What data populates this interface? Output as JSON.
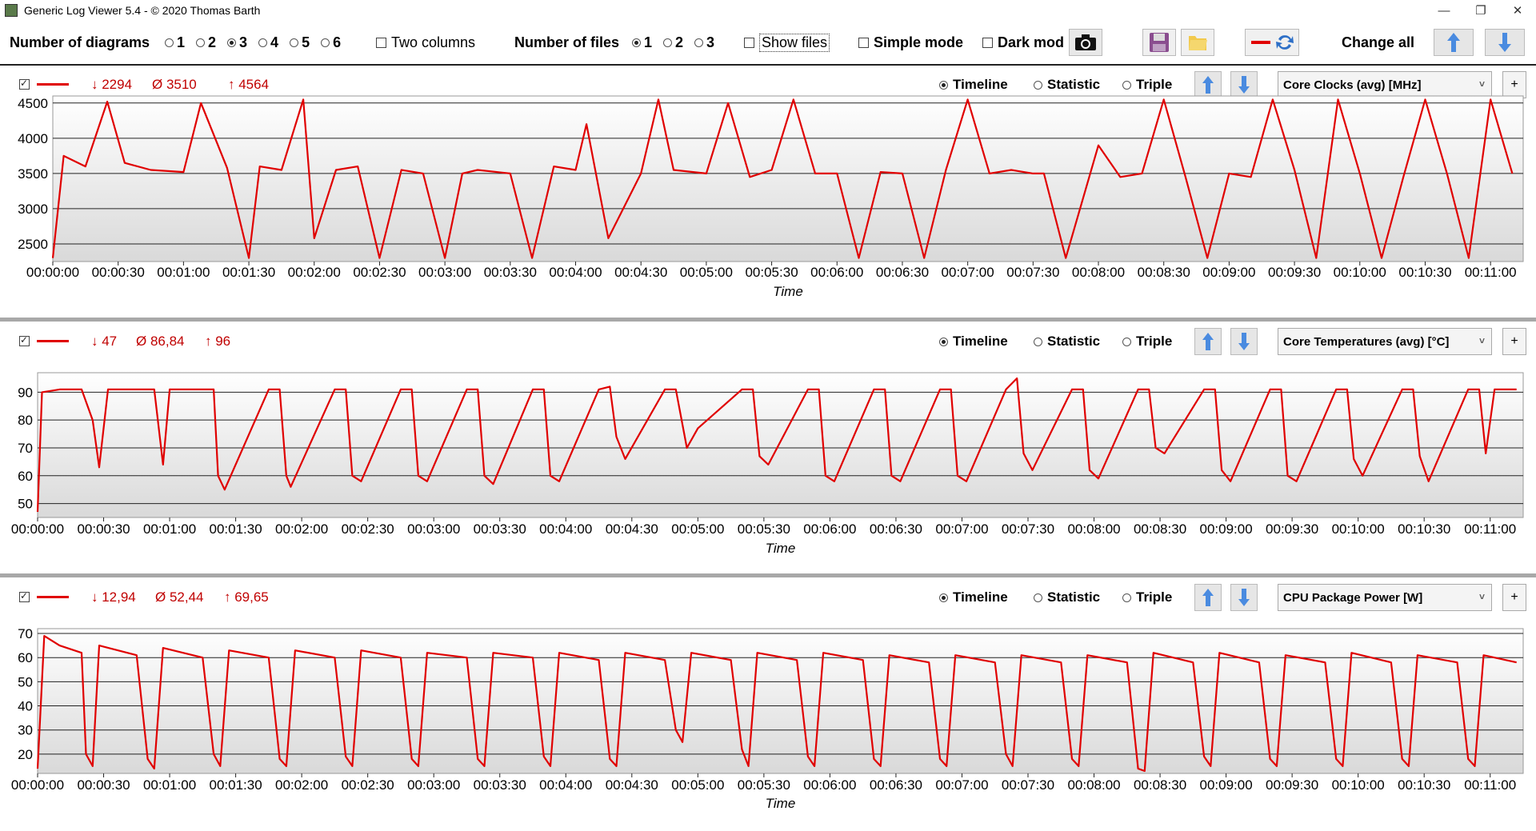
{
  "window": {
    "title": "Generic Log Viewer 5.4 - © 2020 Thomas Barth",
    "min": "—",
    "max": "❐",
    "close": "✕"
  },
  "toolbar": {
    "num_diagrams_label": "Number of diagrams",
    "diagram_options": [
      "1",
      "2",
      "3",
      "4",
      "5",
      "6"
    ],
    "diagram_selected": "3",
    "two_columns": "Two columns",
    "num_files_label": "Number of files",
    "file_options": [
      "1",
      "2",
      "3"
    ],
    "file_selected": "1",
    "show_files": "Show files",
    "simple_mode": "Simple mode",
    "dark_mode": "Dark mod",
    "change_all": "Change all"
  },
  "panels": [
    {
      "stats": {
        "min": "↓ 2294",
        "avg": "Ø 3510",
        "max": "↑ 4564"
      },
      "modes": [
        "Timeline",
        "Statistic",
        "Triple"
      ],
      "mode_selected": "Timeline",
      "sensor": "Core Clocks (avg) [MHz]",
      "plus": "+",
      "xlabel": "Time",
      "xticks": [
        "00:00:00",
        "00:00:30",
        "00:01:00",
        "00:01:30",
        "00:02:00",
        "00:02:30",
        "00:03:00",
        "00:03:30",
        "00:04:00",
        "00:04:30",
        "00:05:00",
        "00:05:30",
        "00:06:00",
        "00:06:30",
        "00:07:00",
        "00:07:30",
        "00:08:00",
        "00:08:30",
        "00:09:00",
        "00:09:30",
        "00:10:00",
        "00:10:30",
        "00:11:00"
      ],
      "yticks": [
        "2500",
        "3000",
        "3500",
        "4000",
        "4500"
      ]
    },
    {
      "stats": {
        "min": "↓ 47",
        "avg": "Ø 86,84",
        "max": "↑ 96"
      },
      "modes": [
        "Timeline",
        "Statistic",
        "Triple"
      ],
      "mode_selected": "Timeline",
      "sensor": "Core Temperatures (avg) [°C]",
      "plus": "+",
      "xlabel": "Time",
      "xticks": [
        "00:00:00",
        "00:00:30",
        "00:01:00",
        "00:01:30",
        "00:02:00",
        "00:02:30",
        "00:03:00",
        "00:03:30",
        "00:04:00",
        "00:04:30",
        "00:05:00",
        "00:05:30",
        "00:06:00",
        "00:06:30",
        "00:07:00",
        "00:07:30",
        "00:08:00",
        "00:08:30",
        "00:09:00",
        "00:09:30",
        "00:10:00",
        "00:10:30",
        "00:11:00"
      ],
      "yticks": [
        "50",
        "60",
        "70",
        "80",
        "90"
      ]
    },
    {
      "stats": {
        "min": "↓ 12,94",
        "avg": "Ø 52,44",
        "max": "↑ 69,65"
      },
      "modes": [
        "Timeline",
        "Statistic",
        "Triple"
      ],
      "mode_selected": "Timeline",
      "sensor": "CPU Package Power [W]",
      "plus": "+",
      "xlabel": "Time",
      "xticks": [
        "00:00:00",
        "00:00:30",
        "00:01:00",
        "00:01:30",
        "00:02:00",
        "00:02:30",
        "00:03:00",
        "00:03:30",
        "00:04:00",
        "00:04:30",
        "00:05:00",
        "00:05:30",
        "00:06:00",
        "00:06:30",
        "00:07:00",
        "00:07:30",
        "00:08:00",
        "00:08:30",
        "00:09:00",
        "00:09:30",
        "00:10:00",
        "00:10:30",
        "00:11:00"
      ],
      "yticks": [
        "20",
        "30",
        "40",
        "50",
        "60",
        "70"
      ]
    }
  ],
  "chart_data": [
    {
      "type": "line",
      "ylabel": "Core Clocks (avg) [MHz]",
      "xlabel": "Time",
      "ylim": [
        2250,
        4600
      ],
      "xlim": [
        "00:00:00",
        "00:11:15"
      ],
      "grid": true,
      "series_color": "#e00000",
      "summary": {
        "min": 2294,
        "avg": 3510,
        "max": 4564
      },
      "x": [
        "00:00:00",
        "00:00:05",
        "00:00:15",
        "00:00:25",
        "00:00:33",
        "00:00:45",
        "00:01:00",
        "00:01:08",
        "00:01:20",
        "00:01:30",
        "00:01:35",
        "00:01:45",
        "00:01:55",
        "00:02:00",
        "00:02:10",
        "00:02:20",
        "00:02:30",
        "00:02:40",
        "00:02:50",
        "00:03:00",
        "00:03:08",
        "00:03:15",
        "00:03:30",
        "00:03:40",
        "00:03:50",
        "00:04:00",
        "00:04:05",
        "00:04:15",
        "00:04:30",
        "00:04:38",
        "00:04:45",
        "00:05:00",
        "00:05:10",
        "00:05:20",
        "00:05:30",
        "00:05:40",
        "00:05:50",
        "00:06:00",
        "00:06:10",
        "00:06:20",
        "00:06:30",
        "00:06:40",
        "00:06:50",
        "00:07:00",
        "00:07:10",
        "00:07:20",
        "00:07:30",
        "00:07:35",
        "00:07:45",
        "00:08:00",
        "00:08:10",
        "00:08:20",
        "00:08:30",
        "00:08:40",
        "00:08:50",
        "00:09:00",
        "00:09:10",
        "00:09:20",
        "00:09:30",
        "00:09:40",
        "00:09:50",
        "00:10:00",
        "00:10:10",
        "00:10:20",
        "00:10:30",
        "00:10:40",
        "00:10:50",
        "00:11:00",
        "00:11:10"
      ],
      "y": [
        2300,
        3750,
        3600,
        4520,
        3650,
        3550,
        3520,
        4500,
        3580,
        2300,
        3600,
        3550,
        4550,
        2580,
        3550,
        3600,
        2300,
        3550,
        3500,
        2300,
        3500,
        3550,
        3500,
        2300,
        3600,
        3550,
        4200,
        2580,
        3500,
        4550,
        3550,
        3500,
        4500,
        3450,
        3550,
        4550,
        3500,
        3500,
        2300,
        3520,
        3500,
        2300,
        3550,
        4550,
        3500,
        3550,
        3500,
        3500,
        2300,
        3900,
        3450,
        3500,
        4550,
        3450,
        2300,
        3500,
        3450,
        4550,
        3550,
        2300,
        4550,
        3500,
        2300,
        3450,
        4550,
        3500,
        2300,
        4550,
        3500
      ]
    },
    {
      "type": "line",
      "ylabel": "Core Temperatures (avg) [°C]",
      "xlabel": "Time",
      "ylim": [
        45,
        97
      ],
      "xlim": [
        "00:00:00",
        "00:11:15"
      ],
      "grid": true,
      "series_color": "#e00000",
      "summary": {
        "min": 47,
        "avg": 86.84,
        "max": 96
      },
      "x": [
        "00:00:00",
        "00:00:02",
        "00:00:10",
        "00:00:20",
        "00:00:25",
        "00:00:28",
        "00:00:32",
        "00:00:45",
        "00:00:53",
        "00:00:57",
        "00:01:00",
        "00:01:15",
        "00:01:20",
        "00:01:22",
        "00:01:25",
        "00:01:45",
        "00:01:50",
        "00:01:53",
        "00:01:55",
        "00:02:15",
        "00:02:20",
        "00:02:23",
        "00:02:27",
        "00:02:45",
        "00:02:50",
        "00:02:53",
        "00:02:57",
        "00:03:15",
        "00:03:20",
        "00:03:23",
        "00:03:27",
        "00:03:45",
        "00:03:50",
        "00:03:53",
        "00:03:57",
        "00:04:15",
        "00:04:20",
        "00:04:23",
        "00:04:27",
        "00:04:45",
        "00:04:50",
        "00:04:55",
        "00:05:00",
        "00:05:20",
        "00:05:25",
        "00:05:28",
        "00:05:32",
        "00:05:50",
        "00:05:55",
        "00:05:58",
        "00:06:02",
        "00:06:20",
        "00:06:25",
        "00:06:28",
        "00:06:32",
        "00:06:50",
        "00:06:55",
        "00:06:58",
        "00:07:02",
        "00:07:20",
        "00:07:25",
        "00:07:28",
        "00:07:32",
        "00:07:50",
        "00:07:55",
        "00:07:58",
        "00:08:02",
        "00:08:20",
        "00:08:25",
        "00:08:28",
        "00:08:32",
        "00:08:50",
        "00:08:55",
        "00:08:58",
        "00:09:02",
        "00:09:20",
        "00:09:25",
        "00:09:28",
        "00:09:32",
        "00:09:50",
        "00:09:55",
        "00:09:58",
        "00:10:02",
        "00:10:20",
        "00:10:25",
        "00:10:28",
        "00:10:32",
        "00:10:50",
        "00:10:55",
        "00:10:58",
        "00:11:02",
        "00:11:12"
      ],
      "y": [
        47,
        90,
        91,
        91,
        80,
        63,
        91,
        91,
        91,
        64,
        91,
        91,
        91,
        60,
        55,
        91,
        91,
        60,
        56,
        91,
        91,
        60,
        58,
        91,
        91,
        60,
        58,
        91,
        91,
        60,
        57,
        91,
        91,
        60,
        58,
        91,
        92,
        74,
        66,
        91,
        91,
        70,
        77,
        91,
        91,
        67,
        64,
        91,
        91,
        60,
        58,
        91,
        91,
        60,
        58,
        91,
        91,
        60,
        58,
        91,
        95,
        68,
        62,
        91,
        91,
        62,
        59,
        91,
        91,
        70,
        68,
        91,
        91,
        62,
        58,
        91,
        91,
        60,
        58,
        91,
        91,
        66,
        60,
        91,
        91,
        67,
        58,
        91,
        91,
        68,
        91,
        91
      ]
    },
    {
      "type": "line",
      "ylabel": "CPU Package Power [W]",
      "xlabel": "Time",
      "ylim": [
        12,
        72
      ],
      "xlim": [
        "00:00:00",
        "00:11:15"
      ],
      "grid": true,
      "series_color": "#e00000",
      "summary": {
        "min": 12.94,
        "avg": 52.44,
        "max": 69.65
      },
      "x": [
        "00:00:00",
        "00:00:03",
        "00:00:10",
        "00:00:20",
        "00:00:22",
        "00:00:25",
        "00:00:28",
        "00:00:45",
        "00:00:50",
        "00:00:53",
        "00:00:57",
        "00:01:15",
        "00:01:20",
        "00:01:23",
        "00:01:27",
        "00:01:45",
        "00:01:50",
        "00:01:53",
        "00:01:57",
        "00:02:15",
        "00:02:20",
        "00:02:23",
        "00:02:27",
        "00:02:45",
        "00:02:50",
        "00:02:53",
        "00:02:57",
        "00:03:15",
        "00:03:20",
        "00:03:23",
        "00:03:27",
        "00:03:45",
        "00:03:50",
        "00:03:53",
        "00:03:57",
        "00:04:15",
        "00:04:20",
        "00:04:23",
        "00:04:27",
        "00:04:45",
        "00:04:50",
        "00:04:53",
        "00:04:57",
        "00:05:15",
        "00:05:20",
        "00:05:23",
        "00:05:27",
        "00:05:45",
        "00:05:50",
        "00:05:53",
        "00:05:57",
        "00:06:15",
        "00:06:20",
        "00:06:23",
        "00:06:27",
        "00:06:45",
        "00:06:50",
        "00:06:53",
        "00:06:57",
        "00:07:15",
        "00:07:20",
        "00:07:23",
        "00:07:27",
        "00:07:45",
        "00:07:50",
        "00:07:53",
        "00:07:57",
        "00:08:15",
        "00:08:20",
        "00:08:23",
        "00:08:27",
        "00:08:45",
        "00:08:50",
        "00:08:53",
        "00:08:57",
        "00:09:15",
        "00:09:20",
        "00:09:23",
        "00:09:27",
        "00:09:45",
        "00:09:50",
        "00:09:53",
        "00:09:57",
        "00:10:15",
        "00:10:20",
        "00:10:23",
        "00:10:27",
        "00:10:45",
        "00:10:50",
        "00:10:53",
        "00:10:57",
        "00:11:12"
      ],
      "y": [
        14,
        69,
        65,
        62,
        20,
        15,
        65,
        61,
        18,
        14,
        64,
        60,
        20,
        15,
        63,
        60,
        18,
        15,
        63,
        60,
        19,
        15,
        63,
        60,
        18,
        15,
        62,
        60,
        18,
        15,
        62,
        60,
        19,
        15,
        62,
        59,
        18,
        15,
        62,
        59,
        30,
        25,
        62,
        59,
        22,
        15,
        62,
        59,
        19,
        15,
        62,
        59,
        18,
        15,
        61,
        58,
        18,
        15,
        61,
        58,
        20,
        15,
        61,
        58,
        18,
        15,
        61,
        58,
        14,
        13,
        62,
        58,
        19,
        15,
        62,
        58,
        18,
        15,
        61,
        58,
        18,
        15,
        62,
        58,
        18,
        15,
        61,
        58,
        18,
        15,
        61,
        58
      ]
    }
  ]
}
